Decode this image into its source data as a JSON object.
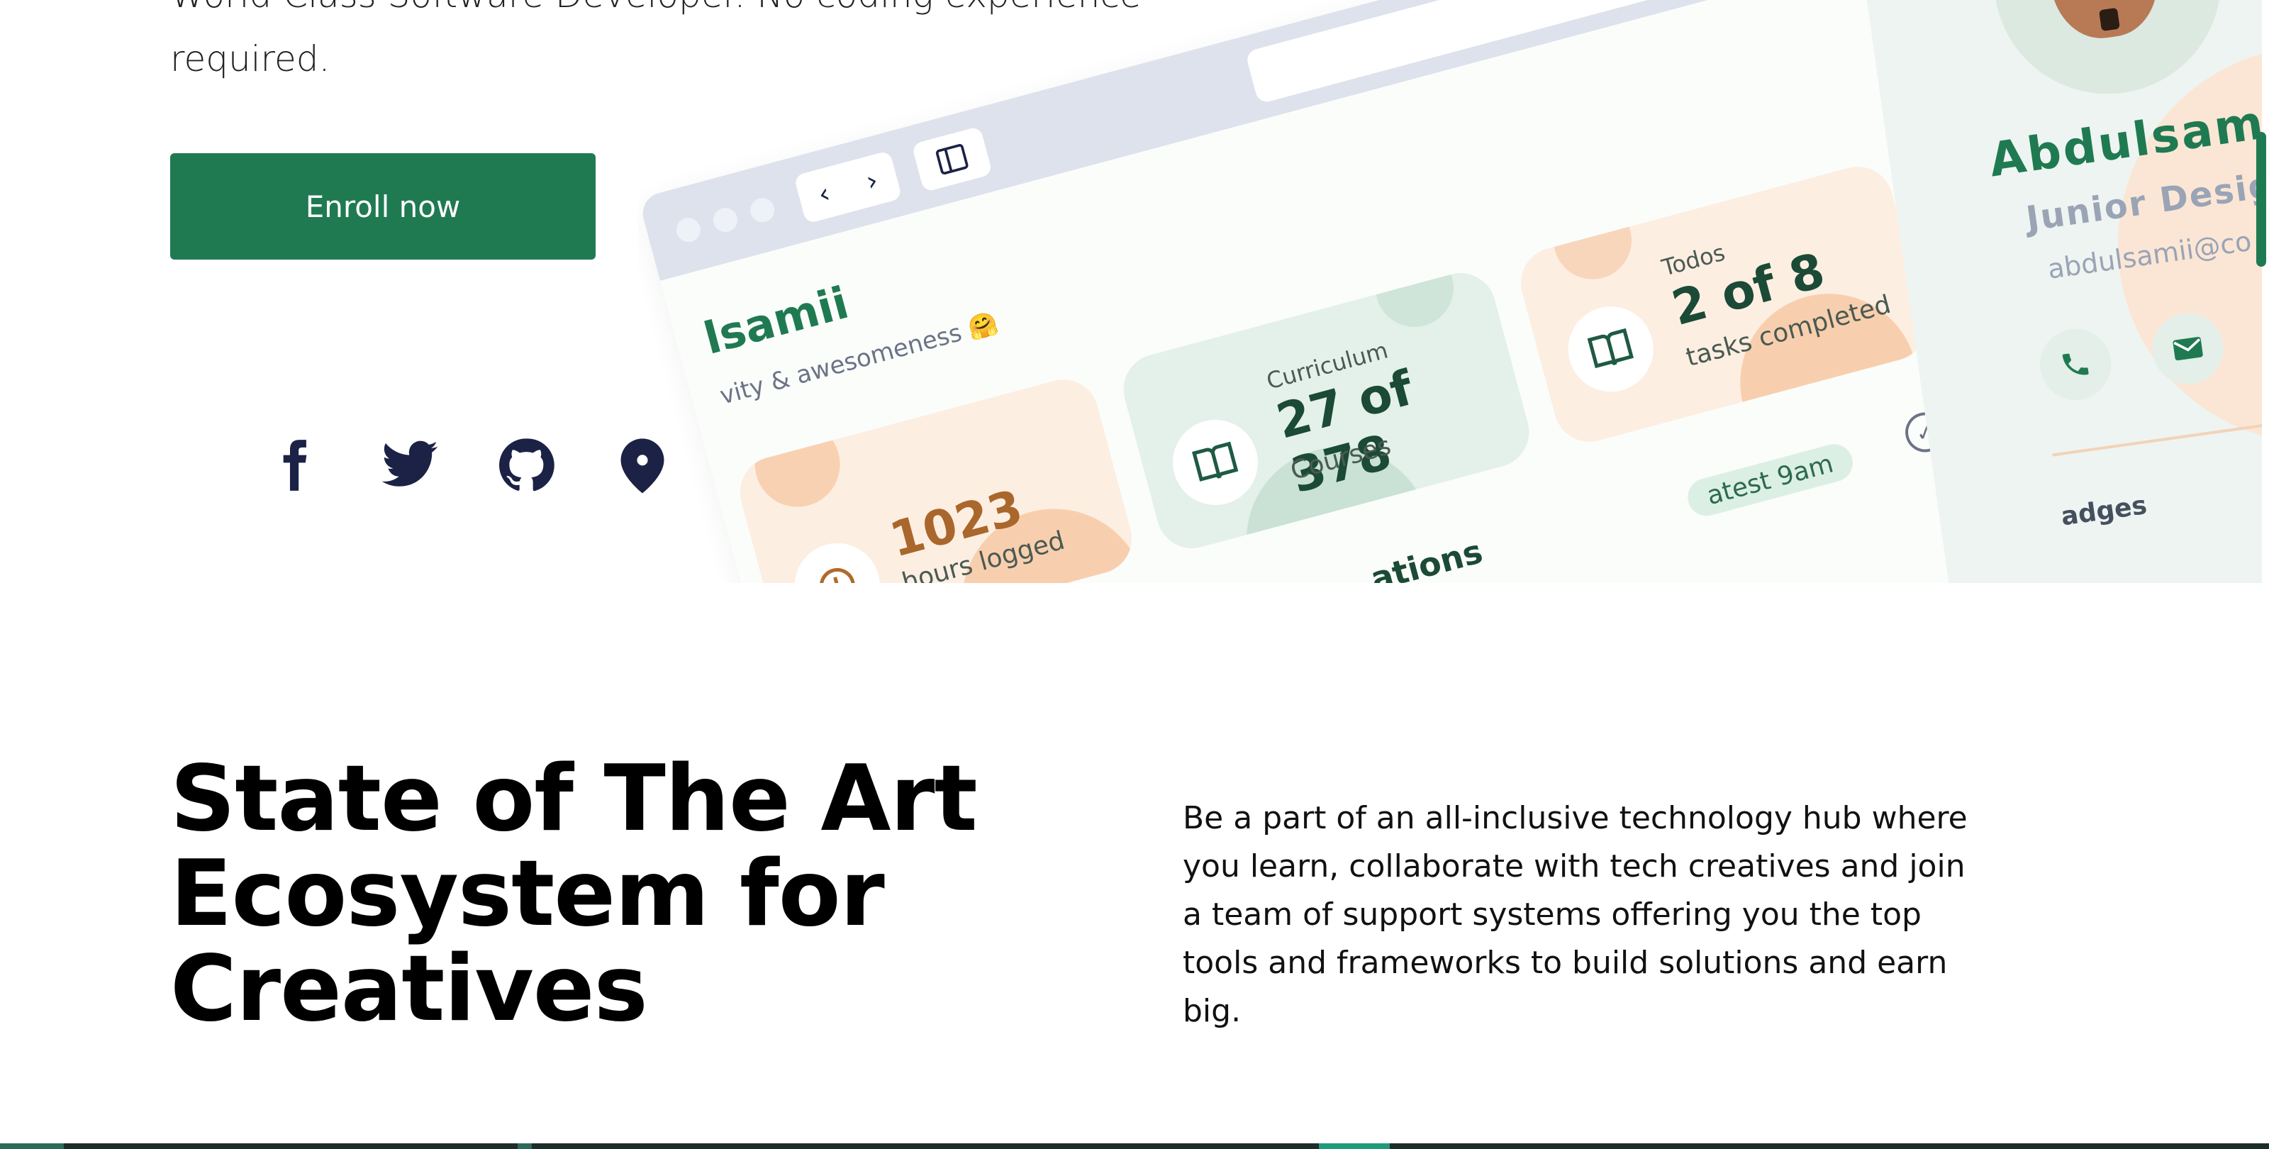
{
  "hero": {
    "text": "World Class Software Developer. No coding experience required.",
    "enroll_label": "Enroll now"
  },
  "socials": [
    {
      "name": "facebook-icon"
    },
    {
      "name": "twitter-icon"
    },
    {
      "name": "github-icon"
    },
    {
      "name": "location-pin-icon"
    }
  ],
  "mockup": {
    "name": "lsamii",
    "subtitle": "vity & awesomeness 🤗",
    "hours_value": "1023",
    "hours_label": "hours logged",
    "curriculum_label": "Curriculum",
    "curriculum_value": "27 of 378",
    "curriculum_sub": "Courses",
    "todos_label": "Todos",
    "todos_value": "2 of 8",
    "todos_sub": "tasks completed",
    "section_title": "ations",
    "latest_label": "atest 9am"
  },
  "profile": {
    "name": "Abdulsamii",
    "role": "Junior Design",
    "email": "abdulsamii@co",
    "badges_label": "adges"
  },
  "ecosystem": {
    "title": "State of The Art Ecosystem for Creatives",
    "description": "Be a part of an all-inclusive technology hub where you learn, collaborate with tech creatives and join a team of support systems offering you the top tools and frameworks to build solutions and earn big."
  },
  "colors": {
    "accent": "#1f7a52",
    "navy": "#1b2246",
    "peach": "#fdeee2",
    "mint": "#e4f0ea"
  }
}
